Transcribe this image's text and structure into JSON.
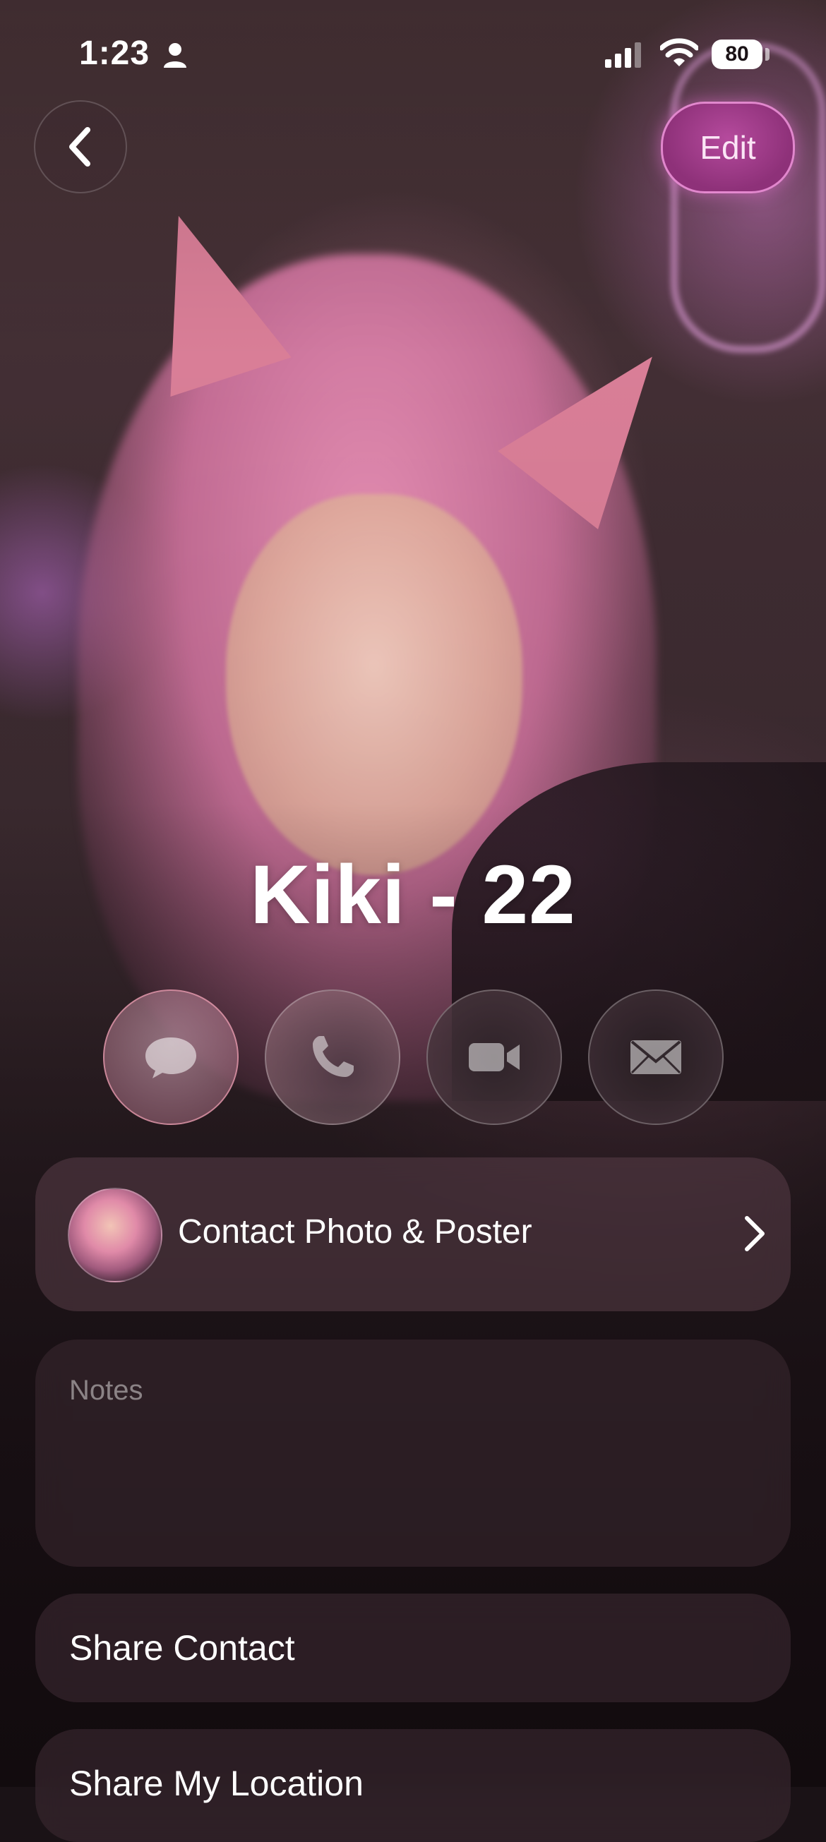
{
  "status_bar": {
    "time": "1:23",
    "battery": "80"
  },
  "nav": {
    "edit_label": "Edit"
  },
  "contact": {
    "name": "Kiki - 22"
  },
  "actions": [
    {
      "name": "message",
      "icon": "message-bubble-icon"
    },
    {
      "name": "call",
      "icon": "phone-icon"
    },
    {
      "name": "video",
      "icon": "video-camera-icon"
    },
    {
      "name": "mail",
      "icon": "envelope-icon"
    }
  ],
  "cards": {
    "photo_poster_label": "Contact Photo & Poster",
    "notes_label": "Notes",
    "share_contact_label": "Share Contact",
    "share_location_label": "Share My Location"
  },
  "colors": {
    "edit_button": "#a03f8c",
    "background": "#1a1216"
  }
}
